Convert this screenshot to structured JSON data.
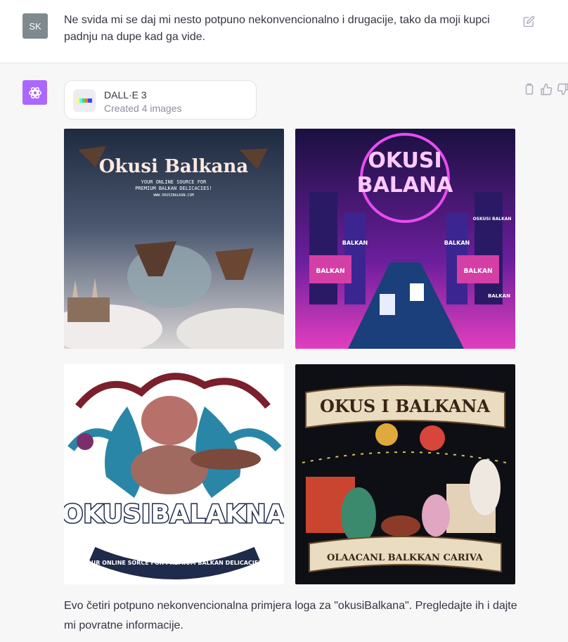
{
  "user_message": {
    "avatar_initials": "SK",
    "text": "Ne svida mi se daj mi nesto potpuno nekonvencionalno i drugacije, tako da moji kupci padnju na dupe kad ga vide."
  },
  "assistant": {
    "tool": {
      "name": "DALL·E 3",
      "status": "Created 4 images"
    },
    "images": [
      {
        "title": "Okusi Balkana",
        "subtitle": "YOUR ONLINE SOURCE FOR",
        "subtitle2": "PREMIUM BALKAN DELICACIES!",
        "url_text": "WWW.OKUSIBALKAN.COM"
      },
      {
        "title_line1": "OKUSI",
        "title_line2": "BALANA",
        "signs": [
          "BALKAN",
          "BALKAN",
          "BALKAN",
          "BALKAN",
          "BALKAN",
          "OSKUSI BALKAN"
        ]
      },
      {
        "title": "OKUSIBALAKNA",
        "tagline": "YOUR ONLINE SORCE FOR PREMIUM BALKAN DELICACIES!"
      },
      {
        "title": "OKUS I BALKANA",
        "banner": "OLAACANL BALKKAN CARIVA"
      }
    ],
    "reply_text": "Evo četiri potpuno nekonvencionalna primjera loga za \"okusiBalkana\". Pregledajte ih i dajte mi povratne informacije."
  },
  "colors": {
    "gpt_purple": "#ab68ff",
    "user_avatar": "#7f8a8e"
  }
}
